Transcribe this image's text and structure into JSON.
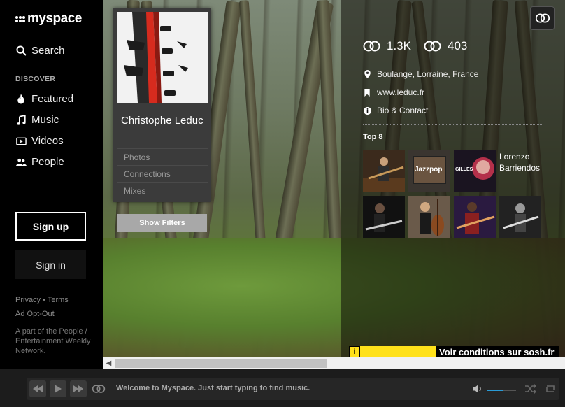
{
  "app": {
    "logo_text": "myspace"
  },
  "sidebar": {
    "search_label": "Search",
    "discover_label": "DISCOVER",
    "items": [
      {
        "label": "Featured",
        "icon": "flame-icon"
      },
      {
        "label": "Music",
        "icon": "music-note-icon"
      },
      {
        "label": "Videos",
        "icon": "video-icon"
      },
      {
        "label": "People",
        "icon": "people-icon"
      }
    ],
    "signup_label": "Sign up",
    "signin_label": "Sign in",
    "privacy_label": "Privacy",
    "terms_label": "Terms",
    "separator": "•",
    "ad_optout_label": "Ad Opt-Out",
    "network_text": "A part of the People / Entertainment Weekly Network."
  },
  "profile": {
    "name": "Christophe Leduc",
    "links": [
      "Photos",
      "Connections",
      "Mixes"
    ],
    "show_filters_label": "Show Filters"
  },
  "stats": {
    "connections_in": "1.3K",
    "connections_out": "403"
  },
  "info": {
    "location": "Boulange, Lorraine, France",
    "website": "www.leduc.fr",
    "bio_label": "Bio & Contact"
  },
  "top8": {
    "title": "Top 8",
    "hover_name": "Lorenzo Barriendos",
    "jazzpop_label": "Jazzpop",
    "gilles_label": "GILLES"
  },
  "ad": {
    "info_glyph": "i",
    "text": "Voir conditions sur sosh.fr"
  },
  "player": {
    "welcome_text": "Welcome to Myspace. Just start typing to find music.",
    "volume": 0.55
  },
  "colors": {
    "accent_blue": "#2a9bd6",
    "ad_yellow": "#ffe11a",
    "guitar_red": "#d62b1e"
  }
}
